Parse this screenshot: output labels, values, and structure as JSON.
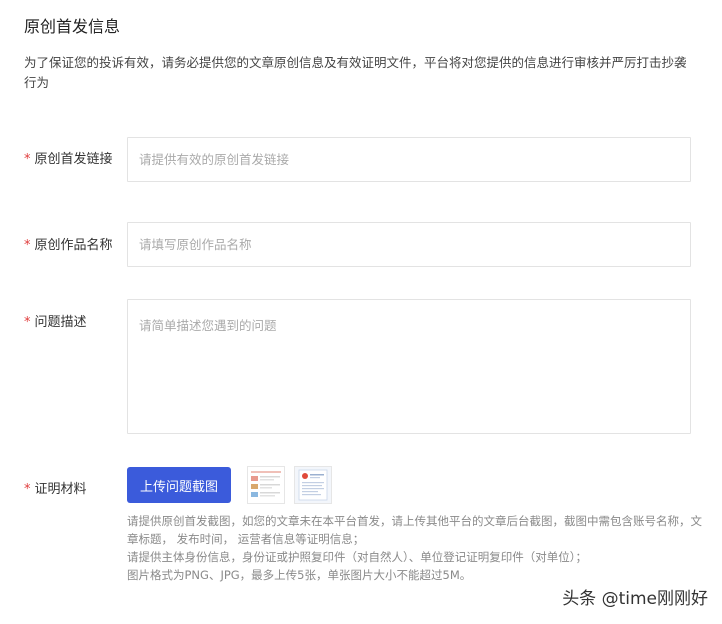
{
  "section": {
    "title": "原创首发信息",
    "description": "为了保证您的投诉有效，请务必提供您的文章原创信息及有效证明文件，平台将对您提供的信息进行审核并严厉打击抄袭行为"
  },
  "form": {
    "required_mark": "*",
    "link": {
      "label": "原创首发链接",
      "placeholder": "请提供有效的原创首发链接",
      "value": ""
    },
    "work_name": {
      "label": "原创作品名称",
      "placeholder": "请填写原创作品名称",
      "value": ""
    },
    "problem": {
      "label": "问题描述",
      "placeholder": "请简单描述您遇到的问题",
      "value": ""
    },
    "evidence": {
      "label": "证明材料",
      "upload_label": "上传问题截图",
      "hints": [
        "请提供原创首发截图，如您的文章未在本平台首发，请上传其他平台的文章后台截图，截图中需包含账号名称，文章标题，  发布时间，  运营者信息等证明信息；",
        "请提供主体身份信息，身份证或护照复印件（对自然人）、单位登记证明复印件（对单位）；",
        "图片格式为PNG、JPG，最多上传5张，单张图片大小不能超过5M。"
      ]
    }
  },
  "watermark": "头条 @time刚刚好",
  "colors": {
    "primary": "#3b5bdb",
    "required": "#e03a3a",
    "border": "#e3e3e3",
    "hint": "#8a8a8a"
  }
}
